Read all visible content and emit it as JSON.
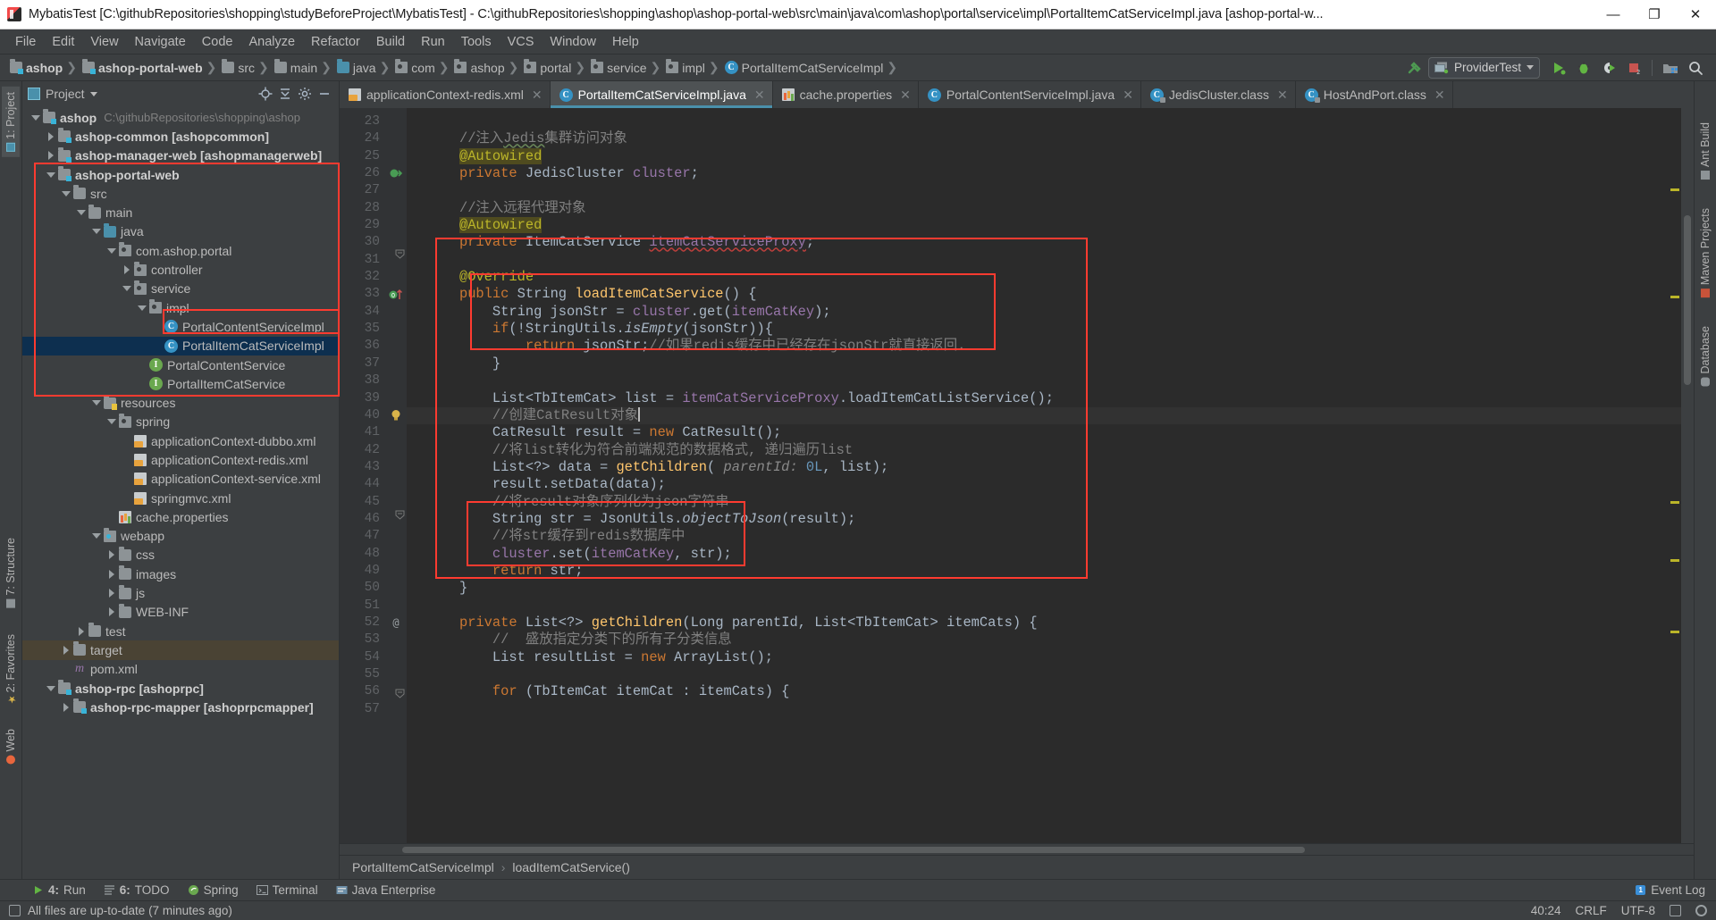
{
  "window": {
    "title": "MybatisTest [C:\\githubRepositories\\shopping\\studyBeforeProject\\MybatisTest] - C:\\githubRepositories\\shopping\\ashop\\ashop-portal-web\\src\\main\\java\\com\\ashop\\portal\\service\\impl\\PortalItemCatServiceImpl.java [ashop-portal-w...",
    "minimize": "—",
    "maximize": "❐",
    "close": "✕"
  },
  "menu": [
    "File",
    "Edit",
    "View",
    "Navigate",
    "Code",
    "Analyze",
    "Refactor",
    "Build",
    "Run",
    "Tools",
    "VCS",
    "Window",
    "Help"
  ],
  "navbar": {
    "crumbs": [
      {
        "label": "ashop",
        "icon": "module-folder-icon",
        "bold": true
      },
      {
        "label": "ashop-portal-web",
        "icon": "module-folder-icon",
        "bold": true
      },
      {
        "label": "src",
        "icon": "folder-icon",
        "bold": false
      },
      {
        "label": "main",
        "icon": "folder-icon",
        "bold": false
      },
      {
        "label": "java",
        "icon": "source-folder-icon",
        "bold": false
      },
      {
        "label": "com",
        "icon": "package-icon",
        "bold": false
      },
      {
        "label": "ashop",
        "icon": "package-icon",
        "bold": false
      },
      {
        "label": "portal",
        "icon": "package-icon",
        "bold": false
      },
      {
        "label": "service",
        "icon": "package-icon",
        "bold": false
      },
      {
        "label": "impl",
        "icon": "package-icon",
        "bold": false
      },
      {
        "label": "PortalItemCatServiceImpl",
        "icon": "class-icon",
        "bold": false
      }
    ],
    "run_config": "ProviderTest"
  },
  "left_strip": [
    {
      "label": "1: Project",
      "active": true
    },
    {
      "label": "7: Structure",
      "active": false
    },
    {
      "label": "2: Favorites",
      "active": false
    },
    {
      "label": "Web",
      "active": false
    }
  ],
  "right_strip": [
    {
      "label": "Ant Build"
    },
    {
      "label": "Maven Projects"
    },
    {
      "label": "Database"
    }
  ],
  "project_panel": {
    "title": "Project",
    "tree": [
      {
        "depth": 0,
        "twist": "down",
        "icon": "module-folder-icon",
        "label": "ashop",
        "bold": true,
        "path": "C:\\githubRepositories\\shopping\\ashop"
      },
      {
        "depth": 1,
        "twist": "right",
        "icon": "module-folder-icon",
        "label": "ashop-common [ashopcommon]",
        "bold": true
      },
      {
        "depth": 1,
        "twist": "right",
        "icon": "module-folder-icon",
        "label": "ashop-manager-web [ashopmanagerweb]",
        "bold": true
      },
      {
        "depth": 1,
        "twist": "down",
        "icon": "module-folder-icon",
        "label": "ashop-portal-web",
        "bold": true
      },
      {
        "depth": 2,
        "twist": "down",
        "icon": "folder-icon",
        "label": "src"
      },
      {
        "depth": 3,
        "twist": "down",
        "icon": "folder-icon",
        "label": "main"
      },
      {
        "depth": 4,
        "twist": "down",
        "icon": "source-folder-icon",
        "label": "java"
      },
      {
        "depth": 5,
        "twist": "down",
        "icon": "package-icon",
        "label": "com.ashop.portal"
      },
      {
        "depth": 6,
        "twist": "right",
        "icon": "package-icon",
        "label": "controller"
      },
      {
        "depth": 6,
        "twist": "down",
        "icon": "package-icon",
        "label": "service"
      },
      {
        "depth": 7,
        "twist": "down",
        "icon": "package-icon",
        "label": "impl"
      },
      {
        "depth": 8,
        "twist": "none",
        "icon": "class-icon",
        "label": "PortalContentServiceImpl"
      },
      {
        "depth": 8,
        "twist": "none",
        "icon": "class-icon",
        "label": "PortalItemCatServiceImpl",
        "selected": true
      },
      {
        "depth": 7,
        "twist": "none",
        "icon": "interface-icon",
        "label": "PortalContentService"
      },
      {
        "depth": 7,
        "twist": "none",
        "icon": "interface-icon",
        "label": "PortalItemCatService"
      },
      {
        "depth": 4,
        "twist": "down",
        "icon": "resources-folder-icon",
        "label": "resources"
      },
      {
        "depth": 5,
        "twist": "down",
        "icon": "package-icon",
        "label": "spring"
      },
      {
        "depth": 6,
        "twist": "none",
        "icon": "xml-file-icon",
        "label": "applicationContext-dubbo.xml"
      },
      {
        "depth": 6,
        "twist": "none",
        "icon": "xml-file-icon",
        "label": "applicationContext-redis.xml"
      },
      {
        "depth": 6,
        "twist": "none",
        "icon": "xml-file-icon",
        "label": "applicationContext-service.xml"
      },
      {
        "depth": 6,
        "twist": "none",
        "icon": "xml-file-icon",
        "label": "springmvc.xml"
      },
      {
        "depth": 5,
        "twist": "none",
        "icon": "properties-file-icon",
        "label": "cache.properties"
      },
      {
        "depth": 4,
        "twist": "down",
        "icon": "webapp-folder-icon",
        "label": "webapp"
      },
      {
        "depth": 5,
        "twist": "right",
        "icon": "folder-icon",
        "label": "css"
      },
      {
        "depth": 5,
        "twist": "right",
        "icon": "folder-icon",
        "label": "images"
      },
      {
        "depth": 5,
        "twist": "right",
        "icon": "folder-icon",
        "label": "js"
      },
      {
        "depth": 5,
        "twist": "right",
        "icon": "folder-icon",
        "label": "WEB-INF"
      },
      {
        "depth": 3,
        "twist": "right",
        "icon": "folder-icon",
        "label": "test"
      },
      {
        "depth": 2,
        "twist": "right",
        "icon": "folder-icon",
        "label": "target",
        "target": true
      },
      {
        "depth": 2,
        "twist": "none",
        "icon": "maven-icon",
        "label": "pom.xml"
      },
      {
        "depth": 1,
        "twist": "down",
        "icon": "module-folder-icon",
        "label": "ashop-rpc [ashoprpc]",
        "bold": true
      },
      {
        "depth": 2,
        "twist": "right",
        "icon": "module-folder-icon",
        "label": "ashop-rpc-mapper [ashoprpcmapper]",
        "bold": true
      }
    ]
  },
  "editor_tabs": [
    {
      "label": "applicationContext-redis.xml",
      "icon": "xml-file-icon",
      "active": false
    },
    {
      "label": "PortalItemCatServiceImpl.java",
      "icon": "class-icon",
      "active": true
    },
    {
      "label": "cache.properties",
      "icon": "properties-file-icon",
      "active": false
    },
    {
      "label": "PortalContentServiceImpl.java",
      "icon": "class-icon",
      "active": false
    },
    {
      "label": "JedisCluster.class",
      "icon": "class-locked-icon",
      "active": false
    },
    {
      "label": "HostAndPort.class",
      "icon": "class-locked-icon",
      "active": false
    }
  ],
  "code": {
    "first_line": 23,
    "lines": [
      {
        "n": 23,
        "html": ""
      },
      {
        "n": 24,
        "html": "    <span class='cm'>//注入<span class='und'>Jedis</span>集群访问对象</span>"
      },
      {
        "n": 25,
        "html": "    <span class='ann-hl'>@Autowired</span>"
      },
      {
        "n": 26,
        "html": "    <span class='kw'>private</span> <span class='typ'>JedisCluster</span> <span class='fld'>cluster</span>;",
        "mark": "override-impl"
      },
      {
        "n": 27,
        "html": ""
      },
      {
        "n": 28,
        "html": "    <span class='cm'>//注入远程代理对象</span>"
      },
      {
        "n": 29,
        "html": "    <span class='ann-hl'>@Autowired</span>"
      },
      {
        "n": 30,
        "html": "    <span class='kw'>private</span> <span class='typ'>ItemCatService</span> <span class='fld undr'>itemCatServiceProxy</span>;"
      },
      {
        "n": 31,
        "html": ""
      },
      {
        "n": 32,
        "html": "    <span class='ann'>@Override</span>"
      },
      {
        "n": 33,
        "html": "    <span class='kw'>public</span> <span class='typ'>String</span> <span class='mth'>loadItemCatService</span>() {",
        "mark": "impl-arrow"
      },
      {
        "n": 34,
        "html": "        <span class='typ'>String</span> jsonStr = <span class='fld'>cluster</span>.get(<span class='fld'>itemCatKey</span>);"
      },
      {
        "n": 35,
        "html": "        <span class='kw'>if</span>(!StringUtils.<span class='ital'>isEmpty</span>(jsonStr)){"
      },
      {
        "n": 36,
        "html": "            <span class='kw'>return</span> jsonStr;<span class='cm'>//如果redis缓存中已经存在jsonStr就直接返回.</span>"
      },
      {
        "n": 37,
        "html": "        }"
      },
      {
        "n": 38,
        "html": ""
      },
      {
        "n": 39,
        "html": "        <span class='typ'>List&lt;TbItemCat&gt;</span> list = <span class='fld'>itemCatServiceProxy</span>.loadItemCatListService();"
      },
      {
        "n": 40,
        "html": "        <span class='cm'>//创建CatResult对象</span><span class='caret-bar'></span>",
        "caretline": true,
        "mark": "bulb"
      },
      {
        "n": 41,
        "html": "        <span class='typ'>CatResult</span> result = <span class='kw'>new</span> <span class='typ'>CatResult</span>();"
      },
      {
        "n": 42,
        "html": "        <span class='cm'>//将list转化为符合前端规范的数据格式, 递归遍历list</span>"
      },
      {
        "n": 43,
        "html": "        <span class='typ'>List&lt;?&gt;</span> data = <span class='mth'>getChildren</span>( <span class='param'>parentId:</span> <span class='num'>0L</span>, list);"
      },
      {
        "n": 44,
        "html": "        result.setData(data);"
      },
      {
        "n": 45,
        "html": "        <span class='cm'>//将result对象序列化为json字符串</span>"
      },
      {
        "n": 46,
        "html": "        <span class='typ'>String</span> str = <span class='typ'>JsonUtils</span>.<span class='ital'>objectToJson</span>(result);"
      },
      {
        "n": 47,
        "html": "        <span class='cm'>//将str缓存到redis数据库中</span>"
      },
      {
        "n": 48,
        "html": "        <span class='fld'>cluster</span>.set(<span class='fld'>itemCatKey</span>, str);"
      },
      {
        "n": 49,
        "html": "        <span class='kw'>return</span> str;"
      },
      {
        "n": 50,
        "html": "    }"
      },
      {
        "n": 51,
        "html": ""
      },
      {
        "n": 52,
        "html": "    <span class='kw'>private</span> <span class='typ'>List&lt;?&gt;</span> <span class='mth'>getChildren</span>(<span class='typ'>Long</span> parentId, <span class='typ'>List&lt;TbItemCat&gt;</span> itemCats) {",
        "mark": "at"
      },
      {
        "n": 53,
        "html": "        <span class='cm'>//  盛放指定分类下的所有子分类信息</span>"
      },
      {
        "n": 54,
        "html": "        <span class='typ'>List</span> resultList = <span class='kw'>new</span> <span class='typ'>ArrayList</span>();"
      },
      {
        "n": 55,
        "html": ""
      },
      {
        "n": 56,
        "html": "        <span class='kw'>for</span> (<span class='typ'>TbItemCat</span> itemCat : itemCats) {"
      },
      {
        "n": 57,
        "html": ""
      }
    ]
  },
  "editor_breadcrumb": [
    "PortalItemCatServiceImpl",
    "loadItemCatService()"
  ],
  "bottom_tools": [
    {
      "num": "4:",
      "label": "Run",
      "icon": "run-icon"
    },
    {
      "num": "6:",
      "label": "TODO",
      "icon": "todo-icon"
    },
    {
      "num": "",
      "label": "Spring",
      "icon": "spring-icon"
    },
    {
      "num": "",
      "label": "Terminal",
      "icon": "terminal-icon"
    },
    {
      "num": "",
      "label": "Java Enterprise",
      "icon": "java-ee-icon"
    }
  ],
  "event_log": "Event Log",
  "statusbar": {
    "message": "All files are up-to-date (7 minutes ago)",
    "caret": "40:24",
    "line_sep": "CRLF",
    "encoding": "UTF-8"
  },
  "colors": {
    "accent": "#4a90ab",
    "annotation_red": "#ff3b30",
    "selection": "#0d2f4f",
    "editor_bg": "#2b2b2b",
    "chrome_bg": "#3c3f41"
  }
}
